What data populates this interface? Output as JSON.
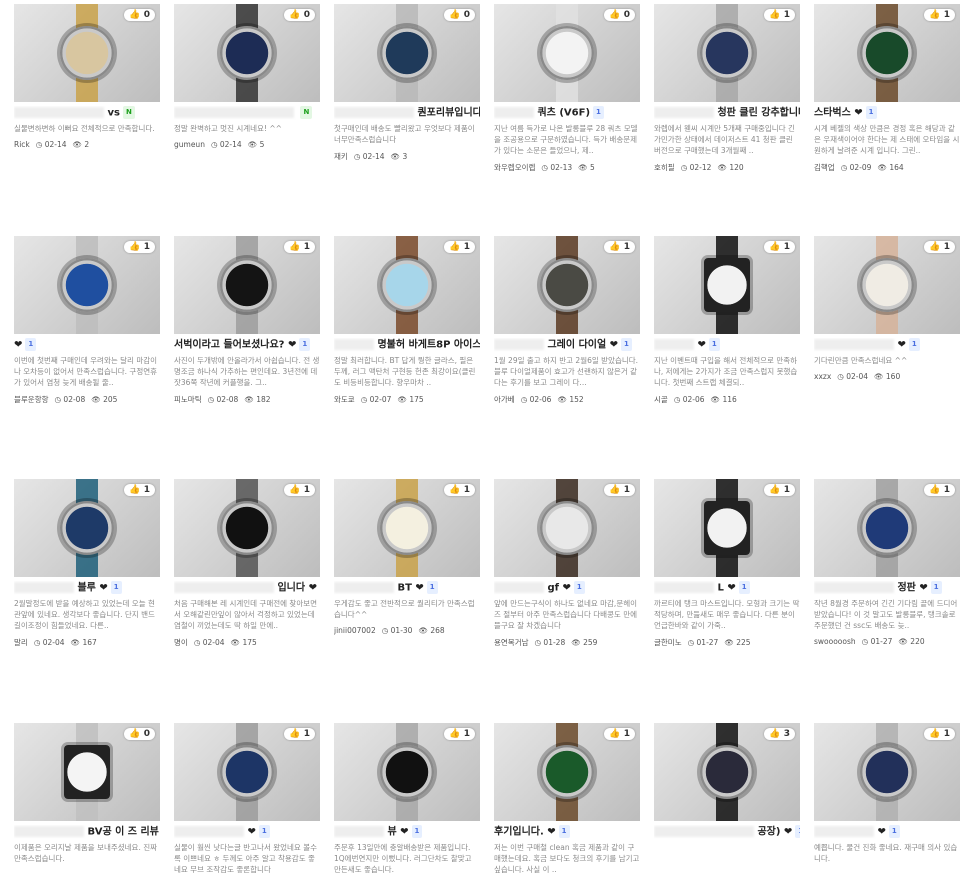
{
  "colors": {
    "accent": "#4a6ee0",
    "new_badge": "#1da01d"
  },
  "icons": {
    "like": "thumbs-up-icon",
    "date": "clock-icon",
    "views": "eye-icon"
  },
  "posts": [
    {
      "likes": "0",
      "title": "vs",
      "new": "N",
      "desc": "실물변하변하 이뻐요 전체적으로 만족합니다.",
      "author": "Rick",
      "date": "02-14",
      "views": "2",
      "dial": "#d8c6a0",
      "strap": "#c9a24a",
      "blur": 90
    },
    {
      "likes": "0",
      "title": "",
      "new": "N",
      "desc": "정말 완벽하고 멋진 시계네요! ^^",
      "author": "gumeun",
      "date": "02-14",
      "views": "5",
      "dial": "#1d2c55",
      "strap": "#333",
      "blur": 120
    },
    {
      "likes": "0",
      "title": "퀀포리뷰입니다",
      "new": "N",
      "desc": "첫구매인데 배송도 빨리왔고 우엇보다 제품이 너무만족스럽습니다",
      "author": "재키",
      "date": "02-14",
      "views": "3",
      "dial": "#1f3a5a",
      "strap": "#b9b9b9",
      "blur": 80
    },
    {
      "likes": "0",
      "title": "쿼츠 (V6F)",
      "new": "",
      "desc": "지난 여름 득가로 나온 발롱블루 28 쿼츠 모델을 조공용으로 구문하였습니다. 득가 배송문제가 있다는 소문은 들었으나, 제..",
      "author": "와우렙오이렙",
      "date": "02-13",
      "views": "5",
      "dial": "#f3f3f3",
      "strap": "#e0e0e0",
      "blur": 40
    },
    {
      "likes": "1",
      "title": "청판 클린 강추합니다",
      "new": "",
      "desc": "와렙에서 웬씨 시계만 5개째 구매중입니다 긴가민가한 상태에서 데이저스트 41 청판 클린 버전으로 구매했는데 3개월째 ..",
      "author": "호히필",
      "date": "02-12",
      "views": "120",
      "dial": "#27365e",
      "strap": "#a8a8a8",
      "blur": 60
    },
    {
      "likes": "1",
      "title": "스타벅스 ❤",
      "new": "",
      "desc": "시계 베젤의 색상 만큼은 경정 혹은 해당과 같은 우재색이어야 한다는 제 스태에 오타임을 시원하게 날려준 시계 입니다. 그린..",
      "author": "김핵업",
      "date": "02-09",
      "views": "164",
      "dial": "#184a2a",
      "strap": "#6b4a2a",
      "blur": 0
    },
    {
      "likes": "1",
      "title": "❤",
      "new": "",
      "desc": "이번에 첫번째 구매인데 우려와는 달리 마감이나 오차등이 없어서 만족스럽습니다. 구정연휴가 있어서 염청 늦게 배송될 줄..",
      "author": "블루운항항",
      "date": "02-08",
      "views": "205",
      "dial": "#1f4fa0",
      "strap": "#bdbdbd",
      "blur": 0
    },
    {
      "likes": "1",
      "title": "서벅이라고 들어보셨나요? ❤",
      "new": "",
      "desc": "사진이 두개밖에 안올라가서 아쉽습니다. 전 생명조금 하나식 가추하는 편인데요. 3년전에 데잣36쭉 작년에 커플행을. 그..",
      "author": "피노마틱",
      "date": "02-08",
      "views": "182",
      "dial": "#141414",
      "strap": "#9e9e9e",
      "blur": 0
    },
    {
      "likes": "1",
      "title": "명불허 바게트8P 아이스토",
      "new": "",
      "desc": "정말 최러합니다. BT 답게 뭥한 글라스, 필은 두께, 러그 맥탄처 구현등 헌존 최강이요(클린도 비등비등합니다. 향우마차 ..",
      "author": "와도쿄",
      "date": "02-07",
      "views": "175",
      "dial": "#a7d6ea",
      "strap": "#7a4a2a",
      "blur": 40
    },
    {
      "likes": "1",
      "title": "그레이 다이얼 ❤",
      "new": "",
      "desc": "1월 29일 출고 하지 반고 2월6일 받았습니다. 블루 다이얼제품이 효고가 선랜하지 않은거 같다는 후기를 보고 그레이 다...",
      "author": "아가베",
      "date": "02-06",
      "views": "152",
      "dial": "#4a4a44",
      "strap": "#5a3a22",
      "blur": 50
    },
    {
      "likes": "1",
      "title": "❤",
      "new": "",
      "desc": "지난 이벤트때 구입을 해서 전체적으로 만족하나, 저에게는 2가지가 조금 만족스럽지 못했습니다. 첫번째 스트랩 체결되..",
      "author": "시골",
      "date": "02-06",
      "views": "116",
      "dial": "#f2f2f2",
      "strap": "#111",
      "blur": 40
    },
    {
      "likes": "1",
      "title": "❤",
      "new": "",
      "desc": "기다린만큼 만족스럽네요 ^^",
      "author": "xxzx",
      "date": "02-04",
      "views": "160",
      "dial": "#f0ece4",
      "strap": "#d6b39a",
      "blur": 80
    },
    {
      "likes": "1",
      "title": "블루 ❤",
      "new": "",
      "desc": "2월말정도에 받을 예상하고 있었는데 오늘 현관앞에 있네요. 생각보다 좋습니다. 단지 밴드 길이조정이 힘들었네요. 다른..",
      "author": "말리",
      "date": "02-04",
      "views": "167",
      "dial": "#1e3a68",
      "strap": "#1f5f7a",
      "blur": 60
    },
    {
      "likes": "1",
      "title": "입니다 ❤",
      "new": "",
      "desc": "처음 구매해본 레 시계인데 구매전에 찾아보면서 오해같린만잎이 않아서 걱정하고 있었는데 염철이 끼었는데도 딱 하일 만에..",
      "author": "명이",
      "date": "02-04",
      "views": "175",
      "dial": "#111",
      "strap": "#555",
      "blur": 100
    },
    {
      "likes": "1",
      "title": "BT ❤",
      "new": "",
      "desc": "우게감도 좋고 전반적으로 퀄리티가 만족스럽습니다^^",
      "author": "jinii007002",
      "date": "01-30",
      "views": "268",
      "dial": "#f4f0e0",
      "strap": "#c9a24a",
      "blur": 60
    },
    {
      "likes": "1",
      "title": "gf ❤",
      "new": "",
      "desc": "앞에 만드는구식이 하나도 없네요 마감,문헤이즈 절부터 아주 만족스럽습니다 다배콩도 만에 뜰구요 잘 차겠습니다",
      "author": "용연목거남",
      "date": "01-28",
      "views": "259",
      "dial": "#e8e8e8",
      "strap": "#3a2a20",
      "blur": 50
    },
    {
      "likes": "1",
      "title": "L ❤",
      "new": "",
      "desc": "까르티에 탱크 마스트입니다. 모형과 크기는 딱 적당하며, 만듦새도 매우 좋습니다. 다른 분이 언급한바와 같이 가죽..",
      "author": "글한미노",
      "date": "01-27",
      "views": "225",
      "dial": "#f2f2f2",
      "strap": "#111",
      "blur": 60
    },
    {
      "likes": "1",
      "title": "정판 ❤",
      "new": "",
      "desc": "작년 8월경 주문하여 긴긴 기다림 끝에 드디어 받았습니다! 이 것 말고도 발롱블루, 탱크솔로 주문했던 건 ssc도 배송도 늦..",
      "author": "swooooosh",
      "date": "01-27",
      "views": "220",
      "dial": "#1f3a78",
      "strap": "#a0a0a0",
      "blur": 80
    },
    {
      "likes": "0",
      "title": "BV공 이 즈 리뷰 ❤",
      "new": "",
      "desc": "이제품은 오리지날 제품을 보내주셨네요. 진짜 만족스럽습니다.",
      "author": "",
      "date": "",
      "views": "",
      "dial": "#f4f4f4",
      "strap": "#c0c0c0",
      "blur": 70
    },
    {
      "likes": "1",
      "title": "❤",
      "new": "",
      "desc": "실물이 훨씬 낫다는글 반고나서 왔었네요 볼수록 이쁘네요 ㅎ 두께도 아주 알고 착용감도 좋네요 무브 조작감도 좋론합니다",
      "author": "",
      "date": "",
      "views": "",
      "dial": "#1d3566",
      "strap": "#9c9c9c",
      "blur": 70
    },
    {
      "likes": "1",
      "title": "뷰 ❤",
      "new": "",
      "desc": "주문후 13일만에 충알배송받은 제품입니다. 1Q에번연지만 이뻤니다. 러그단차도 찰맞고 만든새도 좋습니다.",
      "author": "",
      "date": "",
      "views": "",
      "dial": "#111",
      "strap": "#a8a8a8",
      "blur": 50
    },
    {
      "likes": "1",
      "title": "후기입니다. ❤",
      "new": "",
      "desc": "저는 이번 구매철 clean 혹금 제품과 같이 구매했는데요. 혹금 보다도 청크의 후기를 남기고 싶습니다. 사실 이 ..",
      "author": "",
      "date": "",
      "views": "",
      "dial": "#1a5a2a",
      "strap": "#6b4a2a",
      "blur": 0
    },
    {
      "likes": "3",
      "title": "공장) ❤",
      "new": "",
      "desc": "",
      "author": "",
      "date": "",
      "views": "",
      "dial": "#2a2a3a",
      "strap": "#111",
      "blur": 100
    },
    {
      "likes": "1",
      "title": "❤",
      "new": "",
      "desc": "예쁩니다. 물건 진화 좋네요. 재구매 의사 있습니다.",
      "author": "",
      "date": "",
      "views": "",
      "dial": "#22305a",
      "strap": "#b0b0b0",
      "blur": 60
    }
  ]
}
